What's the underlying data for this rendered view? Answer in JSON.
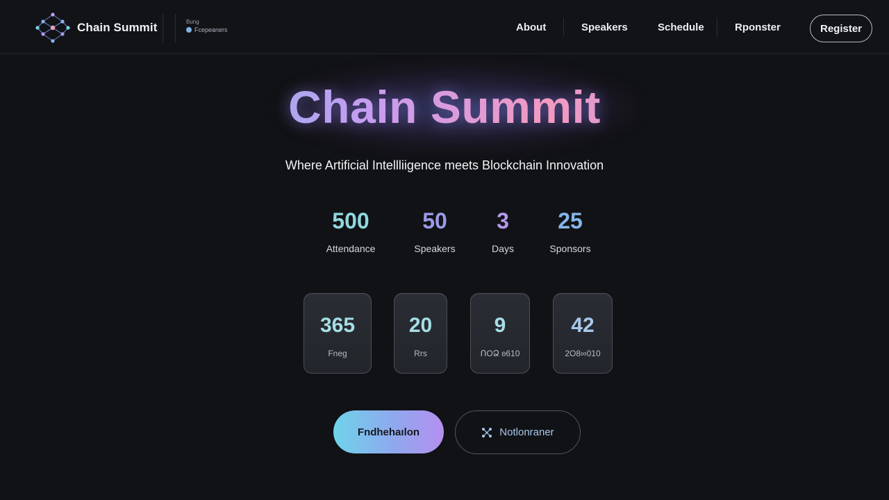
{
  "brand": {
    "name": "Chain Summit",
    "status_small": "Bung",
    "status_label": "Fcepeaners"
  },
  "nav": {
    "about": "About",
    "speakers": "Speakers",
    "schedule": "Schedule",
    "sponsor": "Rponster",
    "register": "Register"
  },
  "hero": {
    "title": "Chain Summit",
    "subtitle": "Where Artificial Intellliigence meets Blockchain Innovation"
  },
  "stats": [
    {
      "value": "500",
      "label": "Attendance",
      "color": "#8fd8e0"
    },
    {
      "value": "50",
      "label": "Speakers",
      "color": "#9c9ae8"
    },
    {
      "value": "3",
      "label": "Days",
      "color": "#b29aea"
    },
    {
      "value": "25",
      "label": "Sponsors",
      "color": "#86b6ea"
    }
  ],
  "countdown": [
    {
      "value": "365",
      "label": "Fneg",
      "color": "#a6dde6"
    },
    {
      "value": "20",
      "label": "Rrs",
      "color": "#a6dde6"
    },
    {
      "value": "9",
      "label": "ՈOՁ ʚ610",
      "color": "#a6dde6"
    },
    {
      "value": "42",
      "label": "2O8∞010",
      "color": "#a7c8ea"
    }
  ],
  "cta": {
    "primary": "Fndhehaılon",
    "secondary": "Notlonraner",
    "secondary_icon": "network-node-icon"
  },
  "colors": {
    "background": "#111215",
    "accent_cyan": "#6fd3ea",
    "accent_purple": "#b58ff0",
    "accent_pink": "#f39ac0"
  }
}
